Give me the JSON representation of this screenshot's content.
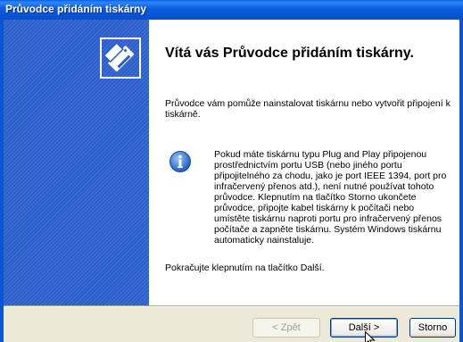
{
  "window": {
    "title": "Průvodce přidáním tiskárny"
  },
  "content": {
    "heading": "Vítá vás Průvodce přidáním tiskárny.",
    "intro": "Průvodce vám pomůže nainstalovat tiskárnu nebo vytvořit připojení k tiskárně.",
    "info": "Pokud máte tiskárnu typu Plug and Play připojenou prostřednictvím portu USB (nebo jiného portu připojitelného za chodu, jako je port IEEE 1394, port pro infračervený přenos atd.), není nutné používat tohoto průvodce. Klepnutím na tlačítko Storno ukončete průvodce, připojte kabel tiskárny k počítači nebo umístěte tiskárnu naproti portu pro infračervený přenos počítače a zapněte tiskárnu. Systém Windows tiskárnu automaticky nainstaluje.",
    "continue": "Pokračujte klepnutím na tlačítko Další."
  },
  "buttons": {
    "back": "< Zpět",
    "next": "Další >",
    "cancel": "Storno"
  },
  "icons": {
    "wizard": "printer-wizard-icon",
    "info": "info-icon",
    "cursor": "mouse-cursor-icon"
  },
  "colors": {
    "titlebar": "#0A56D8",
    "side_panel": "#2A5FCB",
    "face": "#ECE9D8"
  }
}
